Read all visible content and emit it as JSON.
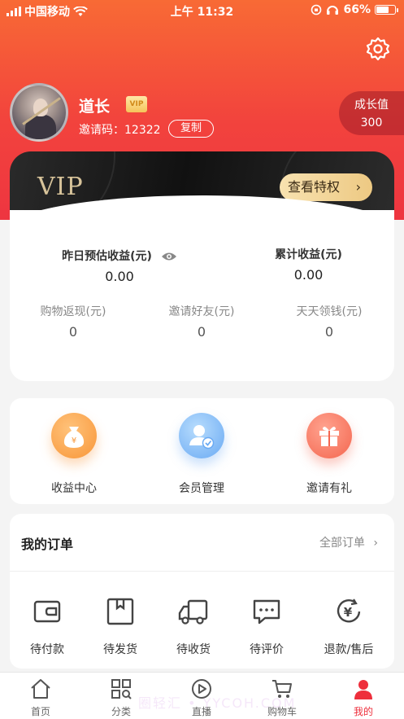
{
  "status_bar": {
    "carrier": "中国移动",
    "time": "上午 11:32",
    "battery": "66%"
  },
  "profile": {
    "name": "道长",
    "vip_badge": "VIP",
    "invite_code_label": "邀请码：12322",
    "copy_label": "复制"
  },
  "growth": {
    "label": "成长值",
    "value": "300"
  },
  "vip_card": {
    "vip_text": "VIP",
    "privilege_label": "查看特权"
  },
  "earnings": {
    "yesterday_label": "昨日预估收益(元)",
    "yesterday_value": "0.00",
    "total_label": "累计收益(元)",
    "total_value": "0.00",
    "stats": [
      {
        "label": "购物返现(元)",
        "value": "0"
      },
      {
        "label": "邀请好友(元)",
        "value": "0"
      },
      {
        "label": "天天领钱(元)",
        "value": "0"
      }
    ]
  },
  "quick_menu": [
    {
      "label": "收益中心",
      "icon": "money-bag-icon"
    },
    {
      "label": "会员管理",
      "icon": "member-icon"
    },
    {
      "label": "邀请有礼",
      "icon": "gift-icon"
    }
  ],
  "orders": {
    "title": "我的订单",
    "all_label": "全部订单",
    "items": [
      {
        "label": "待付款",
        "icon": "wallet-icon"
      },
      {
        "label": "待发货",
        "icon": "box-icon"
      },
      {
        "label": "待收货",
        "icon": "truck-icon"
      },
      {
        "label": "待评价",
        "icon": "comment-icon"
      },
      {
        "label": "退款/售后",
        "icon": "refund-icon"
      }
    ]
  },
  "tabbar": [
    {
      "label": "首页",
      "icon": "home-icon"
    },
    {
      "label": "分类",
      "icon": "category-icon"
    },
    {
      "label": "直播",
      "icon": "live-icon"
    },
    {
      "label": "购物车",
      "icon": "cart-icon"
    },
    {
      "label": "我的",
      "icon": "profile-icon",
      "active": true
    }
  ],
  "watermark": "圈轻汇 • YYCOH.COM",
  "colors": {
    "accent": "#ee2f3c",
    "header_top": "#f86a35",
    "gold": "#edc983"
  }
}
